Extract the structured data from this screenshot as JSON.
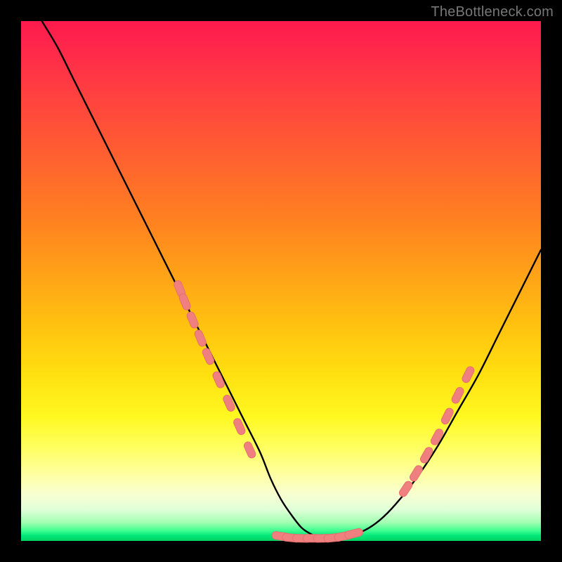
{
  "watermark": "TheBottleneck.com",
  "colors": {
    "curve_stroke": "#000000",
    "marker_fill": "#f08080",
    "marker_stroke": "#e86e6e",
    "background": "#000000"
  },
  "chart_data": {
    "type": "line",
    "title": "",
    "xlabel": "",
    "ylabel": "",
    "xlim": [
      0,
      100
    ],
    "ylim": [
      0,
      100
    ],
    "grid": false,
    "legend": false,
    "series": [
      {
        "name": "bottleneck-curve",
        "x": [
          4,
          7,
          10,
          13,
          16,
          19,
          22,
          25,
          28,
          31,
          34,
          37,
          40,
          43,
          46,
          48,
          50,
          52,
          54,
          56,
          58,
          60,
          63,
          66,
          69,
          72,
          76,
          80,
          84,
          88,
          92,
          96,
          100
        ],
        "values": [
          100,
          95,
          89,
          83,
          77,
          71,
          65,
          59,
          53,
          47,
          41,
          35,
          29,
          23,
          17,
          12,
          8,
          5,
          2.5,
          1.2,
          0.5,
          0.5,
          1,
          2,
          4,
          7,
          12,
          18,
          25,
          32,
          40,
          48,
          56
        ]
      }
    ],
    "markers": {
      "name": "optimal-band-markers",
      "left_slope": {
        "x": [
          30.5,
          31.5,
          33,
          34.5,
          36,
          38,
          40,
          42,
          44
        ],
        "values": [
          48.5,
          46,
          42.5,
          39,
          35.5,
          31,
          26.5,
          22,
          17.5
        ]
      },
      "valley": {
        "x": [
          50,
          52,
          54,
          56,
          58,
          60,
          62,
          64
        ],
        "values": [
          0.9,
          0.6,
          0.5,
          0.5,
          0.5,
          0.6,
          0.9,
          1.4
        ]
      },
      "right_slope": {
        "x": [
          74,
          76,
          78,
          80,
          82,
          84,
          86
        ],
        "values": [
          10,
          13,
          16.5,
          20,
          24,
          28,
          32
        ]
      }
    }
  }
}
